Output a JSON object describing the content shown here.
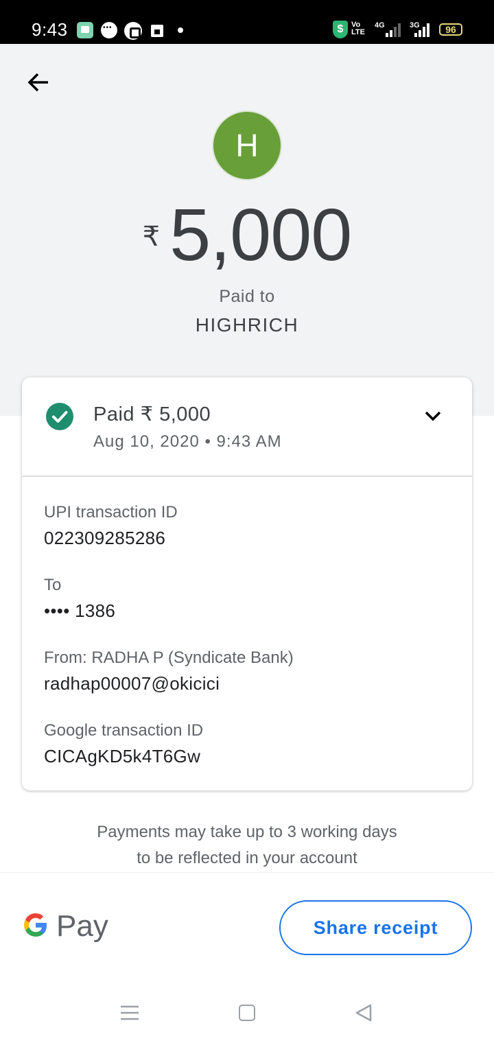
{
  "status_bar": {
    "time": "9:43",
    "volte": "Vo\nLTE",
    "network_1": "4G",
    "network_2": "3G",
    "battery": "96"
  },
  "header": {
    "avatar_letter": "H",
    "currency_symbol": "₹",
    "amount": "5,000",
    "paid_to_label": "Paid to",
    "payee_name": "HIGHRICH"
  },
  "card": {
    "title": "Paid ₹ 5,000",
    "date": "Aug 10, 2020 • 9:43 AM",
    "details": [
      {
        "label": "UPI transaction ID",
        "value": "022309285286"
      },
      {
        "label": "To",
        "value": "•••• 1386"
      },
      {
        "label": "From: RADHA P (Syndicate Bank)",
        "value": "radhap00007@okicici"
      },
      {
        "label": "Google transaction ID",
        "value": "CICAgKD5k4T6Gw"
      }
    ]
  },
  "notice": {
    "line1": "Payments may take up to 3 working days",
    "line2": "to be reflected in your account"
  },
  "footer": {
    "brand": "Pay",
    "share_button": "Share receipt"
  },
  "colors": {
    "accent": "#1a73e8",
    "success": "#1e8e6e",
    "avatar": "#689f38",
    "header_bg": "#f1f3f4"
  }
}
